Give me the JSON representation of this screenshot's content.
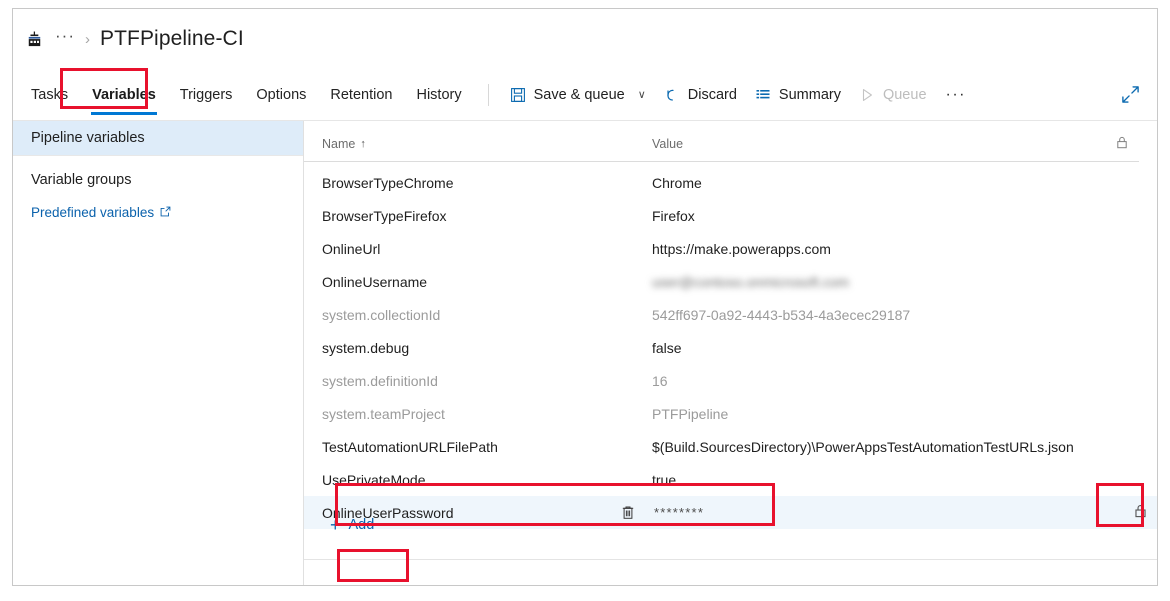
{
  "breadcrumb": {
    "project_icon": "pipeline-factory-icon",
    "ellipsis": "···",
    "separator": "›",
    "title": "PTFPipeline-CI"
  },
  "tabs": [
    {
      "label": "Tasks",
      "active": false
    },
    {
      "label": "Variables",
      "active": true
    },
    {
      "label": "Triggers",
      "active": false
    },
    {
      "label": "Options",
      "active": false
    },
    {
      "label": "Retention",
      "active": false
    },
    {
      "label": "History",
      "active": false
    }
  ],
  "toolbar": {
    "save_queue_label": "Save & queue",
    "save_queue_icon": "save-icon",
    "save_queue_caret": "∨",
    "discard_label": "Discard",
    "discard_icon": "undo-icon",
    "summary_label": "Summary",
    "summary_icon": "list-icon",
    "queue_label": "Queue",
    "queue_icon": "play-icon",
    "queue_disabled": true,
    "overflow_label": "···",
    "expand_icon": "expand-diagonal-icon"
  },
  "sidebar": {
    "items": [
      {
        "label": "Pipeline variables",
        "selected": true
      },
      {
        "label": "Variable groups",
        "selected": false
      }
    ],
    "link": {
      "label": "Predefined variables",
      "external_icon": "external-link-icon"
    }
  },
  "table": {
    "columns": {
      "name": "Name",
      "sort_arrow": "↑",
      "value": "Value",
      "lock_icon": "lock-icon"
    },
    "rows": [
      {
        "name": "BrowserTypeChrome",
        "value": "Chrome",
        "readonly": false,
        "blurred": false,
        "selected": false,
        "masked": false
      },
      {
        "name": "BrowserTypeFirefox",
        "value": "Firefox",
        "readonly": false,
        "blurred": false,
        "selected": false,
        "masked": false
      },
      {
        "name": "OnlineUrl",
        "value": "https://make.powerapps.com",
        "readonly": false,
        "blurred": false,
        "selected": false,
        "masked": false
      },
      {
        "name": "OnlineUsername",
        "value": "user@contoso.onmicrosoft.com",
        "readonly": false,
        "blurred": true,
        "selected": false,
        "masked": false
      },
      {
        "name": "system.collectionId",
        "value": "542ff697-0a92-4443-b534-4a3ecec29187",
        "readonly": true,
        "blurred": false,
        "selected": false,
        "masked": false
      },
      {
        "name": "system.debug",
        "value": "false",
        "readonly": false,
        "blurred": false,
        "selected": false,
        "masked": false
      },
      {
        "name": "system.definitionId",
        "value": "16",
        "readonly": true,
        "blurred": false,
        "selected": false,
        "masked": false
      },
      {
        "name": "system.teamProject",
        "value": "PTFPipeline",
        "readonly": true,
        "blurred": false,
        "selected": false,
        "masked": false
      },
      {
        "name": "TestAutomationURLFilePath",
        "value": "$(Build.SourcesDirectory)\\PowerAppsTestAutomationTestURLs.json",
        "readonly": false,
        "blurred": false,
        "selected": false,
        "masked": false
      },
      {
        "name": "UsePrivateMode",
        "value": "true",
        "readonly": false,
        "blurred": false,
        "selected": false,
        "masked": false
      },
      {
        "name": "OnlineUserPassword",
        "value": "********",
        "readonly": false,
        "blurred": false,
        "selected": true,
        "masked": true,
        "delete_icon": "trash-icon",
        "lock_icon": "lock-closed-icon"
      }
    ]
  },
  "add_button": {
    "plus": "+",
    "label": "Add"
  },
  "annotations": {
    "color": "#e8112d",
    "boxes": [
      {
        "target": "variables-tab"
      },
      {
        "target": "online-user-password-row"
      },
      {
        "target": "lock-cell"
      },
      {
        "target": "add-button"
      }
    ]
  },
  "colors": {
    "accent": "#0078d4",
    "link": "#0b62ac",
    "selected_row": "#eff6fc",
    "selected_sidebar": "#deecf9",
    "annotation": "#e8112d"
  }
}
